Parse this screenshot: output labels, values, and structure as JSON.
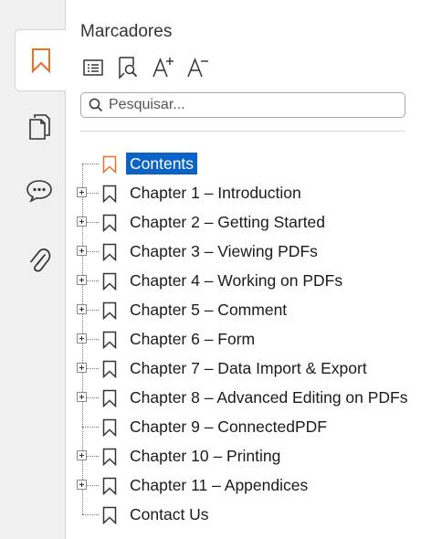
{
  "panel": {
    "title": "Marcadores",
    "search_placeholder": "Pesquisar..."
  },
  "rail": {
    "tabs": [
      {
        "icon": "bookmark-icon",
        "active": true
      },
      {
        "icon": "pages-icon",
        "active": false
      },
      {
        "icon": "comment-icon",
        "active": false
      },
      {
        "icon": "attachment-icon",
        "active": false
      }
    ]
  },
  "toolbar": {
    "buttons": [
      {
        "icon": "bookmark-options-icon"
      },
      {
        "icon": "find-current-bookmark-icon"
      },
      {
        "icon": "increase-font-icon"
      },
      {
        "icon": "decrease-font-icon"
      }
    ]
  },
  "colors": {
    "accent": "#e8702a",
    "selection": "#0b63c6"
  },
  "bookmarks": [
    {
      "label": "Contents",
      "expandable": false,
      "selected": true
    },
    {
      "label": "Chapter 1 – Introduction",
      "expandable": true,
      "selected": false
    },
    {
      "label": "Chapter 2 – Getting Started",
      "expandable": true,
      "selected": false
    },
    {
      "label": "Chapter 3 – Viewing PDFs",
      "expandable": true,
      "selected": false
    },
    {
      "label": "Chapter 4 – Working on PDFs",
      "expandable": true,
      "selected": false
    },
    {
      "label": "Chapter 5 – Comment",
      "expandable": true,
      "selected": false
    },
    {
      "label": "Chapter 6 – Form",
      "expandable": true,
      "selected": false
    },
    {
      "label": "Chapter 7 – Data Import & Export",
      "expandable": true,
      "selected": false
    },
    {
      "label": "Chapter 8 – Advanced Editing on PDFs",
      "expandable": true,
      "selected": false
    },
    {
      "label": "Chapter 9 – ConnectedPDF",
      "expandable": false,
      "selected": false
    },
    {
      "label": "Chapter 10 – Printing",
      "expandable": true,
      "selected": false
    },
    {
      "label": "Chapter 11 – Appendices",
      "expandable": true,
      "selected": false
    },
    {
      "label": "Contact Us",
      "expandable": false,
      "selected": false
    }
  ]
}
